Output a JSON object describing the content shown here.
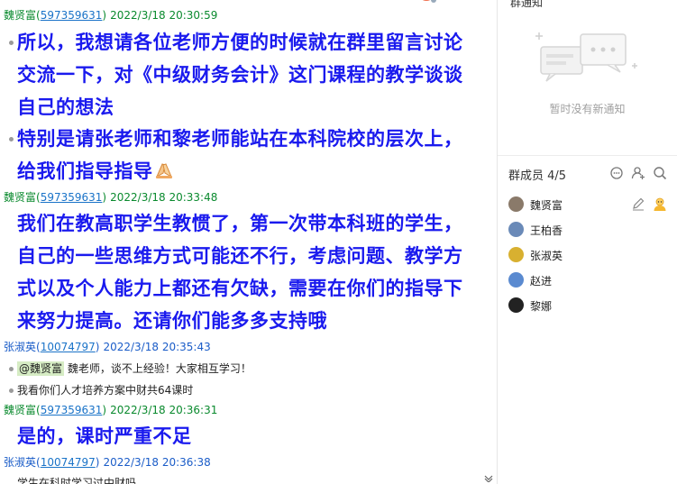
{
  "chat": {
    "messages": [
      {
        "sender": "魏贤富",
        "qq": "597359631",
        "time": "2022/3/18 20:30:59",
        "paragraphs": [
          "所以，我想请各位老师方便的时候就在群里留言讨论交流一下，对《中级财务会计》这门课程的教学谈谈自己的想法",
          "特别是请张老师和黎老师能站在本科院校的层次上，给我们指导指导"
        ]
      },
      {
        "sender": "魏贤富",
        "qq": "597359631",
        "time": "2022/3/18 20:33:48",
        "paragraphs": [
          "我们在教高职学生教惯了，第一次带本科班的学生，自己的一些思维方式可能还不行，考虑问题、教学方式以及个人能力上都还有欠缺，需要在你们的指导下来努力提高。还请你们能多多支持哦"
        ]
      },
      {
        "sender": "张淑英",
        "qq": "10074797",
        "time": "2022/3/18 20:35:43",
        "mention": "@魏贤富",
        "lines": [
          "魏老师，谈不上经验！大家相互学习！",
          "我看你们人才培养方案中财共64课时"
        ]
      },
      {
        "sender": "魏贤富",
        "qq": "597359631",
        "time": "2022/3/18 20:36:31",
        "paragraphs": [
          "是的，课时严重不足"
        ]
      },
      {
        "sender": "张淑英",
        "qq": "10074797",
        "time": "2022/3/18 20:36:38",
        "lines": [
          "学生在科时学习过中财吗"
        ]
      }
    ]
  },
  "sidebar": {
    "notice_title": "群通知",
    "notice_empty": "暂时没有新通知",
    "members_title": "群成员 4/5",
    "members": [
      {
        "name": "魏贤富",
        "color": "#8a7a6a"
      },
      {
        "name": "王柏香",
        "color": "#6a8ab8"
      },
      {
        "name": "张淑英",
        "color": "#d8b030"
      },
      {
        "name": "赵进",
        "color": "#5a8ad0"
      },
      {
        "name": "黎娜",
        "color": "#222222"
      }
    ]
  },
  "icons": [
    "chat-bubble-icon",
    "add-member-icon",
    "search-icon",
    "edit-icon",
    "admin-avatar-icon",
    "scroll-down-icon",
    "praying-hands-icon"
  ]
}
